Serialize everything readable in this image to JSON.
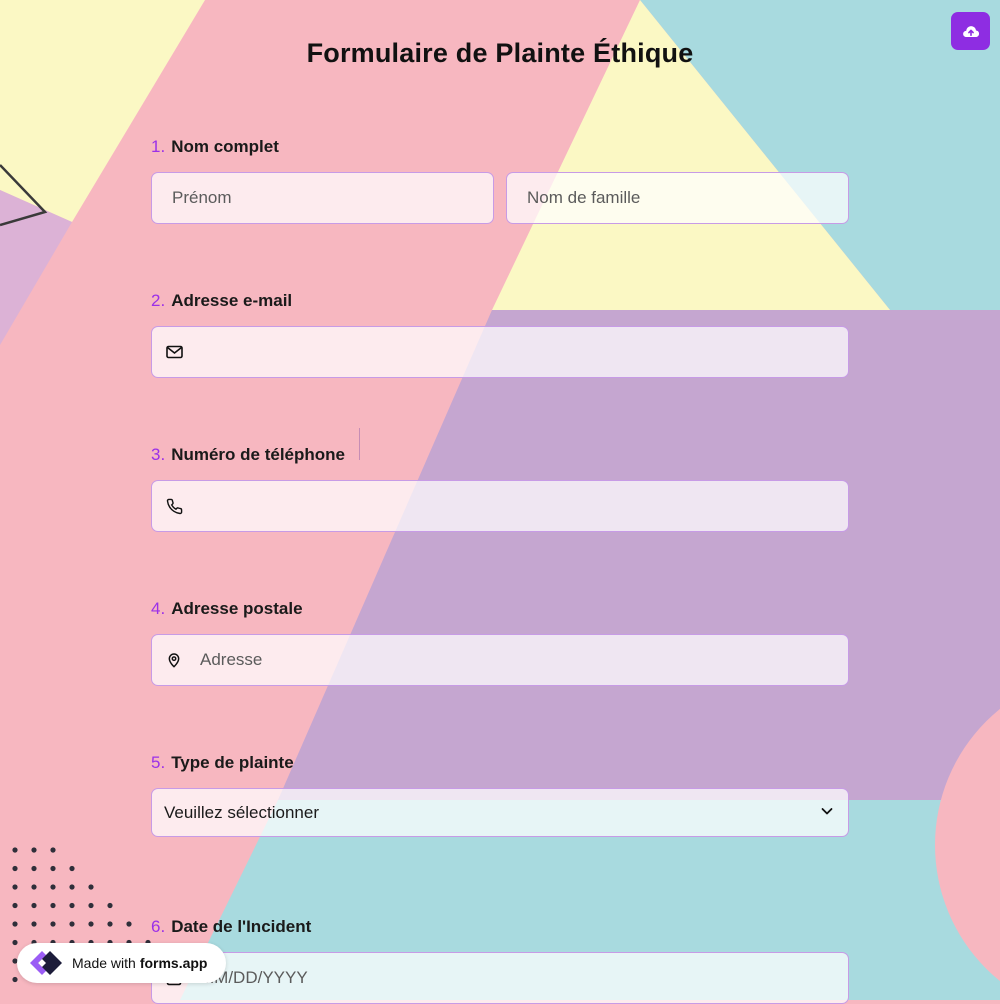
{
  "form": {
    "title": "Formulaire de Plainte Éthique",
    "questions": [
      {
        "number": "1.",
        "label": "Nom complet",
        "fields": [
          {
            "placeholder": "Prénom"
          },
          {
            "placeholder": "Nom de famille"
          }
        ]
      },
      {
        "number": "2.",
        "label": "Adresse e-mail",
        "icon": "mail-icon"
      },
      {
        "number": "3.",
        "label": "Numéro de téléphone",
        "icon": "phone-icon"
      },
      {
        "number": "4.",
        "label": "Adresse postale",
        "icon": "map-pin-icon",
        "placeholder": "Adresse"
      },
      {
        "number": "5.",
        "label": "Type de plainte",
        "select_value": "Veuillez sélectionner"
      },
      {
        "number": "6.",
        "label": "Date de l'Incident",
        "icon": "calendar-icon",
        "placeholder": "MM/DD/YYYY"
      }
    ]
  },
  "header": {
    "upload_icon": "cloud-upload-icon"
  },
  "badge": {
    "made_with": "Made with",
    "brand": "forms.app"
  },
  "colors": {
    "accent": "#8e2de2",
    "pink": "#f7b7c0",
    "yellow": "#fbf8c4",
    "teal": "#a8dadf",
    "lavender": "#c5a6d0"
  }
}
